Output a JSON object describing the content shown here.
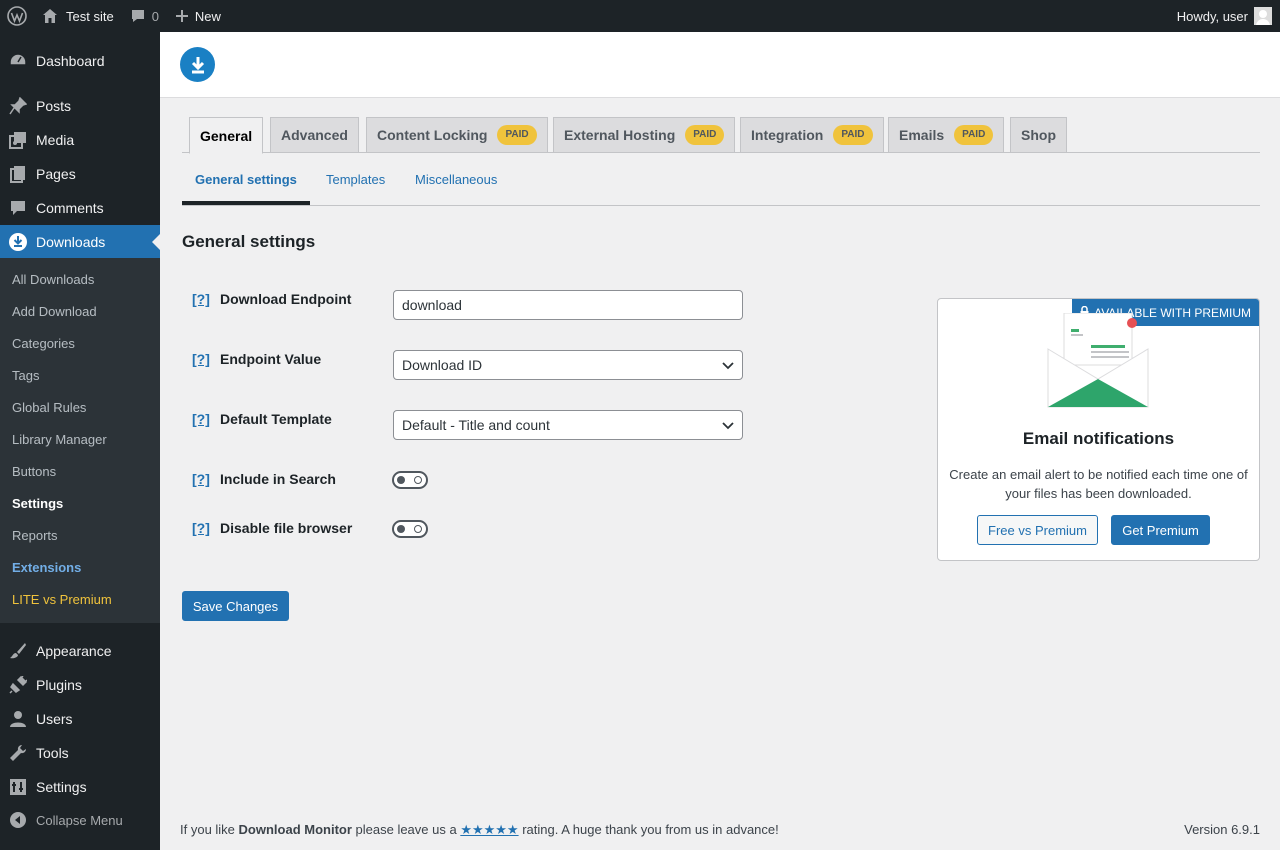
{
  "adminbar": {
    "site_name": "Test site",
    "comments_count": "0",
    "new_label": "New",
    "howdy": "Howdy, user"
  },
  "sidebar": {
    "items": [
      {
        "label": "Dashboard",
        "icon": "dashboard-icon"
      },
      {
        "label": "Posts",
        "icon": "pin-icon"
      },
      {
        "label": "Media",
        "icon": "media-icon"
      },
      {
        "label": "Pages",
        "icon": "pages-icon"
      },
      {
        "label": "Comments",
        "icon": "comment-icon"
      },
      {
        "label": "Downloads",
        "icon": "download-icon"
      },
      {
        "label": "Appearance",
        "icon": "brush-icon"
      },
      {
        "label": "Plugins",
        "icon": "plugin-icon"
      },
      {
        "label": "Users",
        "icon": "user-icon"
      },
      {
        "label": "Tools",
        "icon": "wrench-icon"
      },
      {
        "label": "Settings",
        "icon": "settings-icon"
      }
    ],
    "submenu": [
      "All Downloads",
      "Add Download",
      "Categories",
      "Tags",
      "Global Rules",
      "Library Manager",
      "Buttons",
      "Settings",
      "Reports",
      "Extensions",
      "LITE vs Premium"
    ],
    "collapse": "Collapse Menu"
  },
  "tabs": [
    {
      "label": "General",
      "paid": ""
    },
    {
      "label": "Advanced",
      "paid": ""
    },
    {
      "label": "Content Locking",
      "paid": "PAID"
    },
    {
      "label": "External Hosting",
      "paid": "PAID"
    },
    {
      "label": "Integration",
      "paid": "PAID"
    },
    {
      "label": "Emails",
      "paid": "PAID"
    },
    {
      "label": "Shop",
      "paid": ""
    }
  ],
  "subtabs": [
    "General settings",
    "Templates",
    "Miscellaneous"
  ],
  "section_title": "General settings",
  "help_label": "[?]",
  "fields": {
    "endpoint": {
      "label": "Download Endpoint",
      "value": "download"
    },
    "endpoint_value": {
      "label": "Endpoint Value",
      "value": "Download ID"
    },
    "template": {
      "label": "Default Template",
      "value": "Default - Title and count"
    },
    "search": {
      "label": "Include in Search",
      "checked": false
    },
    "browser": {
      "label": "Disable file browser",
      "checked": false
    }
  },
  "save_label": "Save Changes",
  "premium": {
    "badge": "AVAILABLE WITH PREMIUM",
    "title": "Email notifications",
    "description": "Create an email alert to be notified each time one of your files has been downloaded.",
    "btn_compare": "Free vs Premium",
    "btn_get": "Get Premium"
  },
  "footer": {
    "prefix": "If you like ",
    "plugin": "Download Monitor",
    "middle": " please leave us a ",
    "stars": "★★★★★",
    "suffix": " rating. A huge thank you from us in advance!",
    "version": "Version 6.9.1"
  },
  "colors": {
    "accent": "#2271b1",
    "sidebar_bg": "#1d2327",
    "paid_badge": "#f0c33c"
  }
}
